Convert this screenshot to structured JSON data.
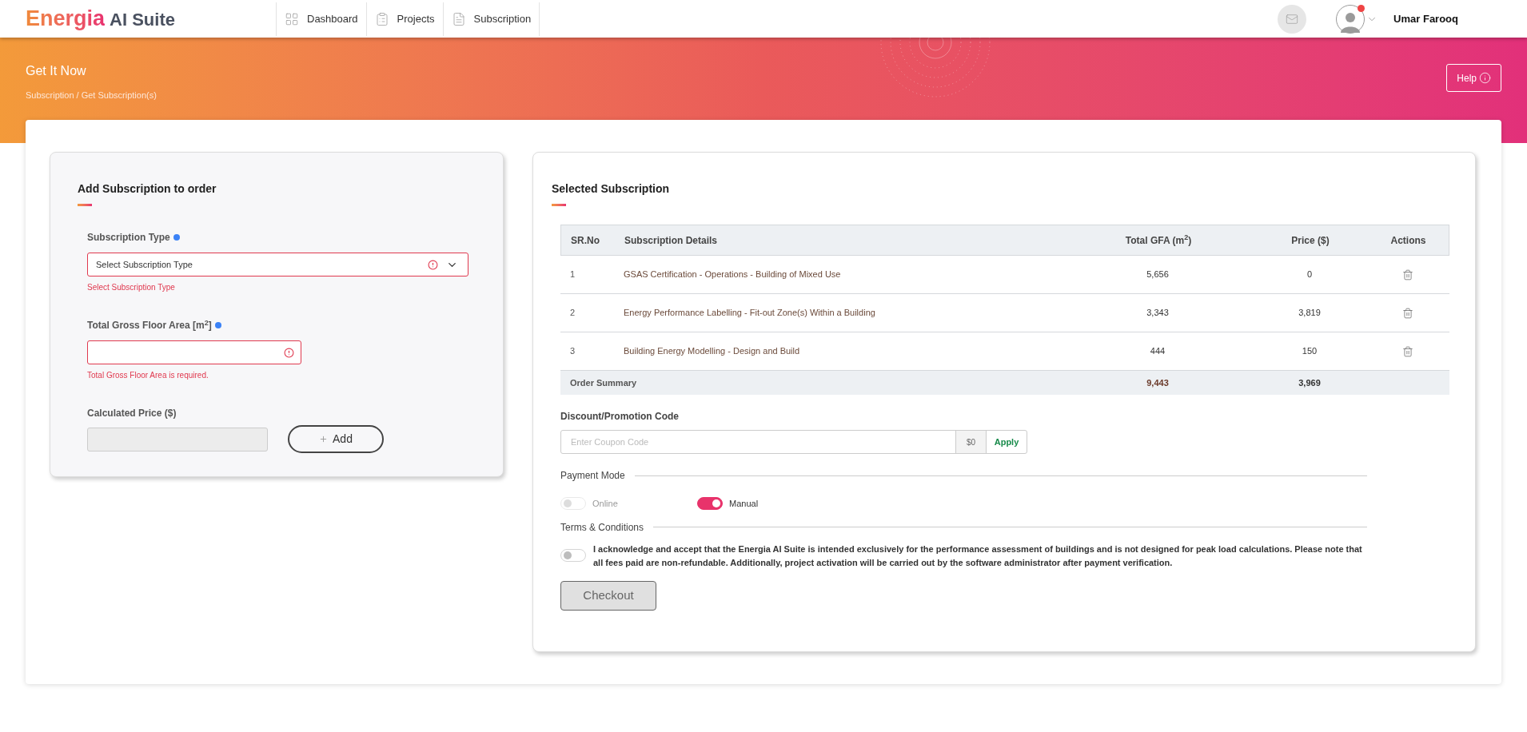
{
  "header": {
    "logo": {
      "brand": "Energia",
      "suffix": "AI Suite"
    },
    "nav": [
      {
        "label": "Dashboard"
      },
      {
        "label": "Projects"
      },
      {
        "label": "Subscription"
      }
    ],
    "user": {
      "name": "Umar Farooq",
      "has_notification": true
    }
  },
  "banner": {
    "title": "Get It Now",
    "breadcrumb": "Subscription / Get Subscription(s)",
    "help_button": "Help"
  },
  "add_panel": {
    "title": "Add Subscription to order",
    "subscription_type": {
      "label": "Subscription Type",
      "value": "Select Subscription Type",
      "error": "Select Subscription Type",
      "invalid": true
    },
    "gross_floor_area": {
      "label": "Total Gross Floor Area [m$^{2}$]",
      "error": "Total Gross Floor Area is required.",
      "invalid": true
    },
    "calculated_price": {
      "label": "Calculated Price ($)",
      "disabled": true
    },
    "add_button": "Add"
  },
  "selected_panel": {
    "title": "Selected Subscription",
    "table": {
      "columns": [
        "SR.No",
        "Subscription Details",
        "Total GFA (m$^{2}$)",
        "Price ($)",
        "Actions"
      ],
      "rows": [
        {
          "sr": "1",
          "details": "GSAS Certification - Operations - Building of Mixed Use",
          "gfa": "5,656",
          "price": "0"
        },
        {
          "sr": "2",
          "details": "Energy Performance Labelling - Fit-out Zone(s) Within a Building",
          "gfa": "3,343",
          "price": "3,819"
        },
        {
          "sr": "3",
          "details": "Building Energy Modelling - Design and Build",
          "gfa": "444",
          "price": "150"
        }
      ],
      "summary": {
        "label": "Order Summary",
        "gfa": "9,443",
        "price": "3,969"
      }
    },
    "discount": {
      "label": "Discount/Promotion Code",
      "placeholder": "Enter Coupon Code",
      "amount": "$0",
      "apply_button": "Apply"
    },
    "payment_mode": {
      "label": "Payment Mode",
      "options": [
        {
          "label": "Online",
          "on": false,
          "disabled": true
        },
        {
          "label": "Manual",
          "on": true,
          "disabled": false
        }
      ]
    },
    "terms": {
      "label": "Terms & Conditions",
      "text": "I acknowledge and accept that the Energia AI Suite is intended exclusively for the performance assessment of buildings and is not designed for peak load calculations. Please note that all fees paid are non-refundable. Additionally, project activation will be carried out by the software administrator after payment verification.",
      "accepted": false
    },
    "checkout_button": "Checkout"
  }
}
